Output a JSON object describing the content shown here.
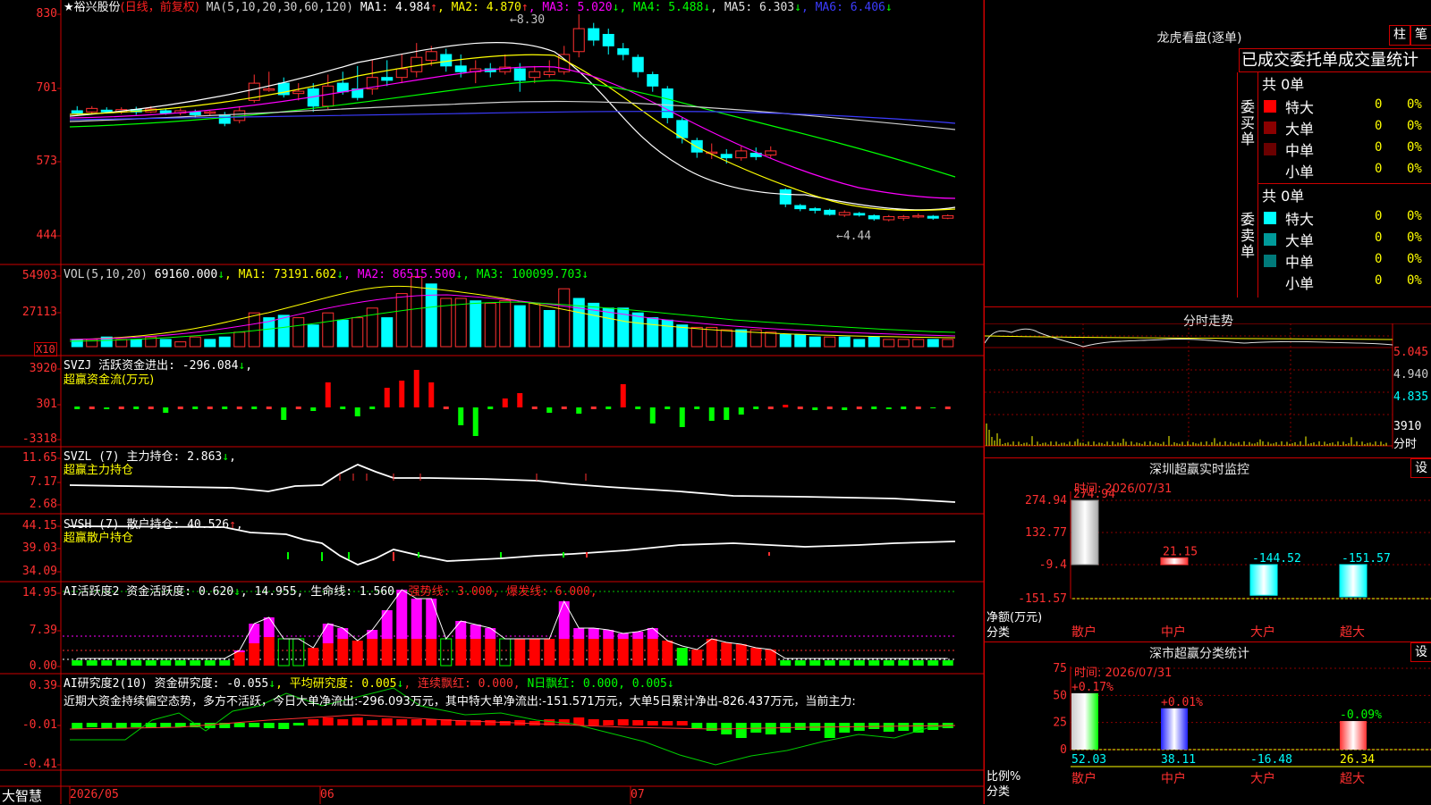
{
  "stock": {
    "name": "★裕兴股份",
    "mode": "(日线，前复权)"
  },
  "main": {
    "ma_header": [
      {
        "t": "MA(5,10,20,30,60,120)",
        "c": "#d0d0d0"
      },
      {
        "t": " MA1: 4.984",
        "c": "#ffffff"
      },
      {
        "t": "↑",
        "c": "#ff3030"
      },
      {
        "t": ", MA2: 4.870",
        "c": "#ffff00"
      },
      {
        "t": "↑",
        "c": "#ff3030"
      },
      {
        "t": ", MA3: 5.020",
        "c": "#ff00ff"
      },
      {
        "t": "↓",
        "c": "#00ff00"
      },
      {
        "t": ", MA4: 5.488",
        "c": "#00ff00"
      },
      {
        "t": "↓",
        "c": "#00ff00"
      },
      {
        "t": ", MA5: 6.303",
        "c": "#e0e0e0"
      },
      {
        "t": "↓",
        "c": "#00ff00"
      },
      {
        "t": ", MA6: 6.406",
        "c": "#3c3cff"
      },
      {
        "t": "↓",
        "c": "#00ff00"
      }
    ],
    "y_ticks": [
      "830",
      "701",
      "573",
      "444"
    ],
    "high_label": "8.30",
    "low_label": "4.44"
  },
  "vol": {
    "header": [
      {
        "t": "VOL(5,10,20)",
        "c": "#d0d0d0"
      },
      {
        "t": "  69160.000",
        "c": "#ffffff"
      },
      {
        "t": "↓",
        "c": "#00ff00"
      },
      {
        "t": ", MA1: 73191.602",
        "c": "#ffff00"
      },
      {
        "t": "↓",
        "c": "#00ff00"
      },
      {
        "t": ", MA2: 86515.500",
        "c": "#ff00ff"
      },
      {
        "t": "↓",
        "c": "#00ff00"
      },
      {
        "t": ", MA3: 100099.703",
        "c": "#00ff00"
      },
      {
        "t": "↓",
        "c": "#00ff00"
      }
    ],
    "y_ticks": [
      "54903",
      "27113"
    ],
    "unit": "X10"
  },
  "svzj": {
    "header": [
      {
        "t": "SVZJ  活跃资金进出: -296.084",
        "c": "#ffffff"
      },
      {
        "t": "↓",
        "c": "#00ff00"
      },
      {
        "t": ",",
        "c": "#ffffff"
      }
    ],
    "sub": "超赢资金流(万元)",
    "y_ticks": [
      "3920",
      "301",
      "-3318"
    ]
  },
  "svzl": {
    "header": [
      {
        "t": "SVZL (7) 主力持仓: 2.863",
        "c": "#ffffff"
      },
      {
        "t": "↓",
        "c": "#00ff00"
      },
      {
        "t": ",",
        "c": "#ffffff"
      }
    ],
    "sub": "超赢主力持仓",
    "y_ticks": [
      "11.65",
      "7.17",
      "2.68"
    ]
  },
  "svsh": {
    "header": [
      {
        "t": "SVSH (7) 散户持仓: 40.526",
        "c": "#ffffff"
      },
      {
        "t": "↑",
        "c": "#ff3030"
      },
      {
        "t": ",",
        "c": "#ffffff"
      }
    ],
    "sub": "超赢散户持仓",
    "y_ticks": [
      "44.15",
      "39.03",
      "34.09"
    ]
  },
  "ai1": {
    "header": [
      {
        "t": "AI活跃度2 资金活跃度: 0.620",
        "c": "#ffffff"
      },
      {
        "t": "↓",
        "c": "#00ff00"
      },
      {
        "t": ", 14.955, 生命线: 1.560,",
        "c": "#ffffff"
      },
      {
        "t": " 强势线: 3.000, 爆发线: 6.000,",
        "c": "#ff2020"
      }
    ],
    "y_ticks": [
      "14.95",
      "7.39",
      "0.00"
    ]
  },
  "ai2": {
    "header": [
      {
        "t": "AI研究度2(10) 资金研究度: -0.055",
        "c": "#ffffff"
      },
      {
        "t": "↓",
        "c": "#00ff00"
      },
      {
        "t": ", 平均研究度: 0.005",
        "c": "#ffff00"
      },
      {
        "t": "↓",
        "c": "#00ff00"
      },
      {
        "t": ", 连续飘红: 0.000,",
        "c": "#ff3030"
      },
      {
        "t": " N日飘红: 0.000, 0.005",
        "c": "#00ff00"
      },
      {
        "t": "↓",
        "c": "#00ff00"
      }
    ],
    "comment": "近期大资金持续偏空态势，多方不活跃，今日大单净流出:-296.093万元，其中特大单净流出:-151.571万元，大单5日累计净出-826.437万元，当前主力:",
    "y_ticks": [
      "0.39",
      "-0.01",
      "-0.41"
    ]
  },
  "x_axis": {
    "brand": "大智慧",
    "dates": [
      "2026/05",
      "06",
      "07"
    ]
  },
  "dragon": {
    "title": "龙虎看盘(逐单)",
    "tab1": "柱",
    "tab2": "笔",
    "subtitle": "已成交委托单成交量统计",
    "buy": {
      "label": "委买单",
      "total": "共 0单",
      "rows": [
        {
          "name": "特大",
          "val": "0",
          "pct": "0%",
          "color": "#ff0000"
        },
        {
          "name": "大单",
          "val": "0",
          "pct": "0%",
          "color": "#8b0000"
        },
        {
          "name": "中单",
          "val": "0",
          "pct": "0%",
          "color": "#6b0000"
        },
        {
          "name": "小单",
          "val": "0",
          "pct": "0%",
          "color": "#000000"
        }
      ]
    },
    "sell": {
      "label": "委卖单",
      "total": "共 0单",
      "rows": [
        {
          "name": "特大",
          "val": "0",
          "pct": "0%",
          "color": "#00ffff"
        },
        {
          "name": "大单",
          "val": "0",
          "pct": "0%",
          "color": "#009a9a"
        },
        {
          "name": "中单",
          "val": "0",
          "pct": "0%",
          "color": "#007a7a"
        },
        {
          "name": "小单",
          "val": "0",
          "pct": "0%",
          "color": "#000000"
        }
      ]
    }
  },
  "intraday": {
    "title": "分时走势",
    "y_ticks": [
      "5.045",
      "4.940",
      "4.835"
    ],
    "vol_label": "3910",
    "vol_unit": "分时"
  },
  "monitor": {
    "title": "深圳超赢实时监控",
    "set": "设",
    "time": "时间: 2026/07/31",
    "y_ticks": [
      "274.94",
      "132.77",
      "-9.4",
      "-151.57"
    ],
    "bars": [
      {
        "label": "274.94",
        "value": 274.94,
        "cat": "散户"
      },
      {
        "label": "21.15",
        "value": 21.15,
        "cat": "中户"
      },
      {
        "label": "-144.52",
        "value": -144.52,
        "cat": "大户"
      },
      {
        "label": "-151.57",
        "value": -151.57,
        "cat": "超大"
      }
    ],
    "ylabel1": "净额(万元)",
    "ylabel2": "分类"
  },
  "classify": {
    "title": "深市超赢分类统计",
    "set": "设",
    "time": "时间: 2026/07/31",
    "y_ticks": [
      "75",
      "50",
      "25",
      "0"
    ],
    "bars": [
      {
        "top": "+0.17%",
        "bottom": "52.03",
        "value": 52.03,
        "cat": "散户"
      },
      {
        "top": "+0.01%",
        "bottom": "38.11",
        "value": 38.11,
        "cat": "中户"
      },
      {
        "top": "",
        "bottom": "-16.48",
        "value": -16.48,
        "cat": "大户"
      },
      {
        "top": "-0.09%",
        "bottom": "26.34",
        "value": 26.34,
        "cat": "超大"
      }
    ],
    "ylabel1": "比例%",
    "ylabel2": "分类"
  }
}
